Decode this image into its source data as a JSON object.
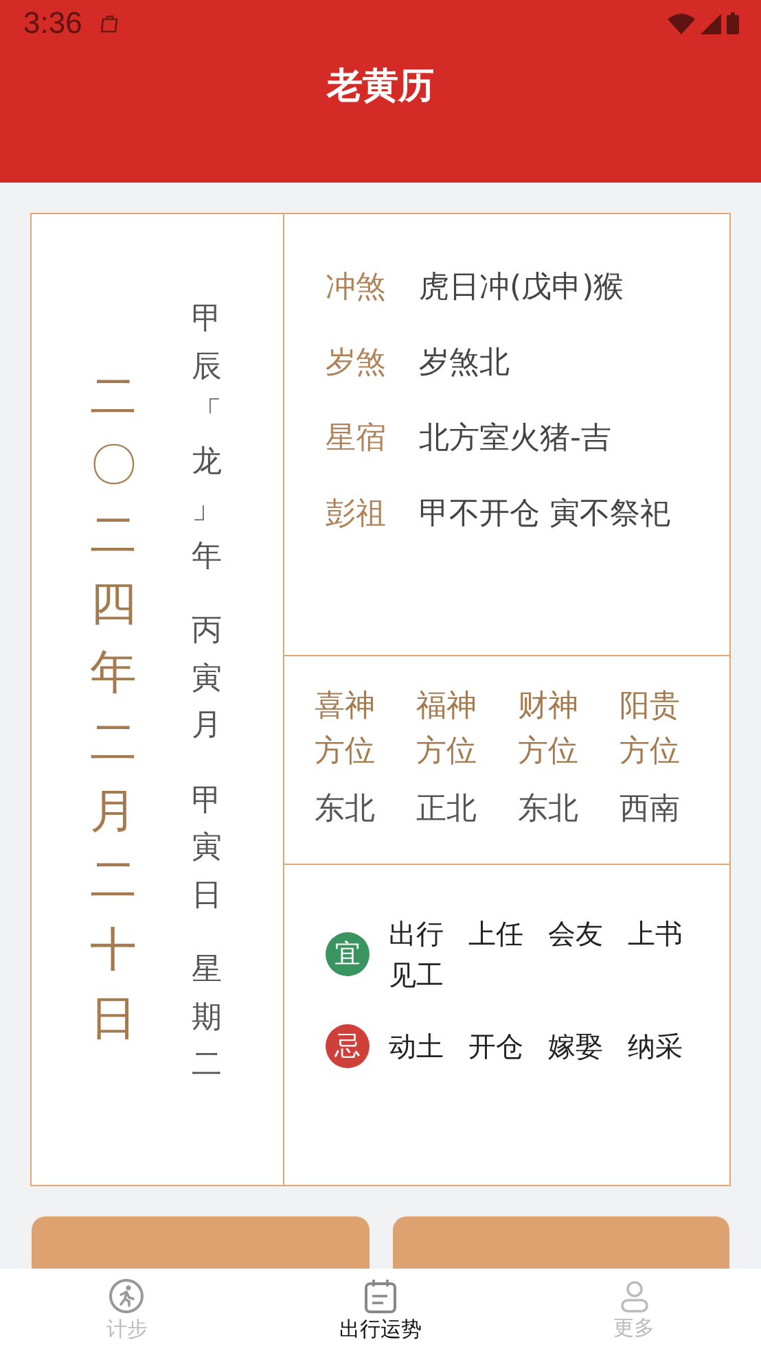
{
  "status_bar": {
    "time": "3:36"
  },
  "header": {
    "title": "老黄历"
  },
  "date_column": {
    "solar_date": "二〇二四年二月二十日",
    "lunar_parts": [
      "甲辰「龙」年",
      "丙寅月",
      "甲寅日",
      "星期二"
    ]
  },
  "details": [
    {
      "label": "冲煞",
      "value": "虎日冲(戊申)猴"
    },
    {
      "label": "岁煞",
      "value": "岁煞北"
    },
    {
      "label": "星宿",
      "value": "北方室火猪-吉"
    },
    {
      "label": "彭祖",
      "value": "甲不开仓 寅不祭祀"
    }
  ],
  "directions": [
    {
      "label": "喜神方位",
      "value": "东北"
    },
    {
      "label": "福神方位",
      "value": "正北"
    },
    {
      "label": "财神方位",
      "value": "东北"
    },
    {
      "label": "阳贵方位",
      "value": "西南"
    }
  ],
  "advice": [
    {
      "badge": "宜",
      "color": "#3a9460",
      "items": [
        "出行",
        "上任",
        "会友",
        "上书",
        "见工"
      ]
    },
    {
      "badge": "忌",
      "color": "#d0403a",
      "items": [
        "动土",
        "开仓",
        "嫁娶",
        "纳采"
      ]
    }
  ],
  "bottom_nav": [
    {
      "label": "计步",
      "selected": false
    },
    {
      "label": "出行运势",
      "selected": true
    },
    {
      "label": "更多",
      "selected": false
    }
  ]
}
